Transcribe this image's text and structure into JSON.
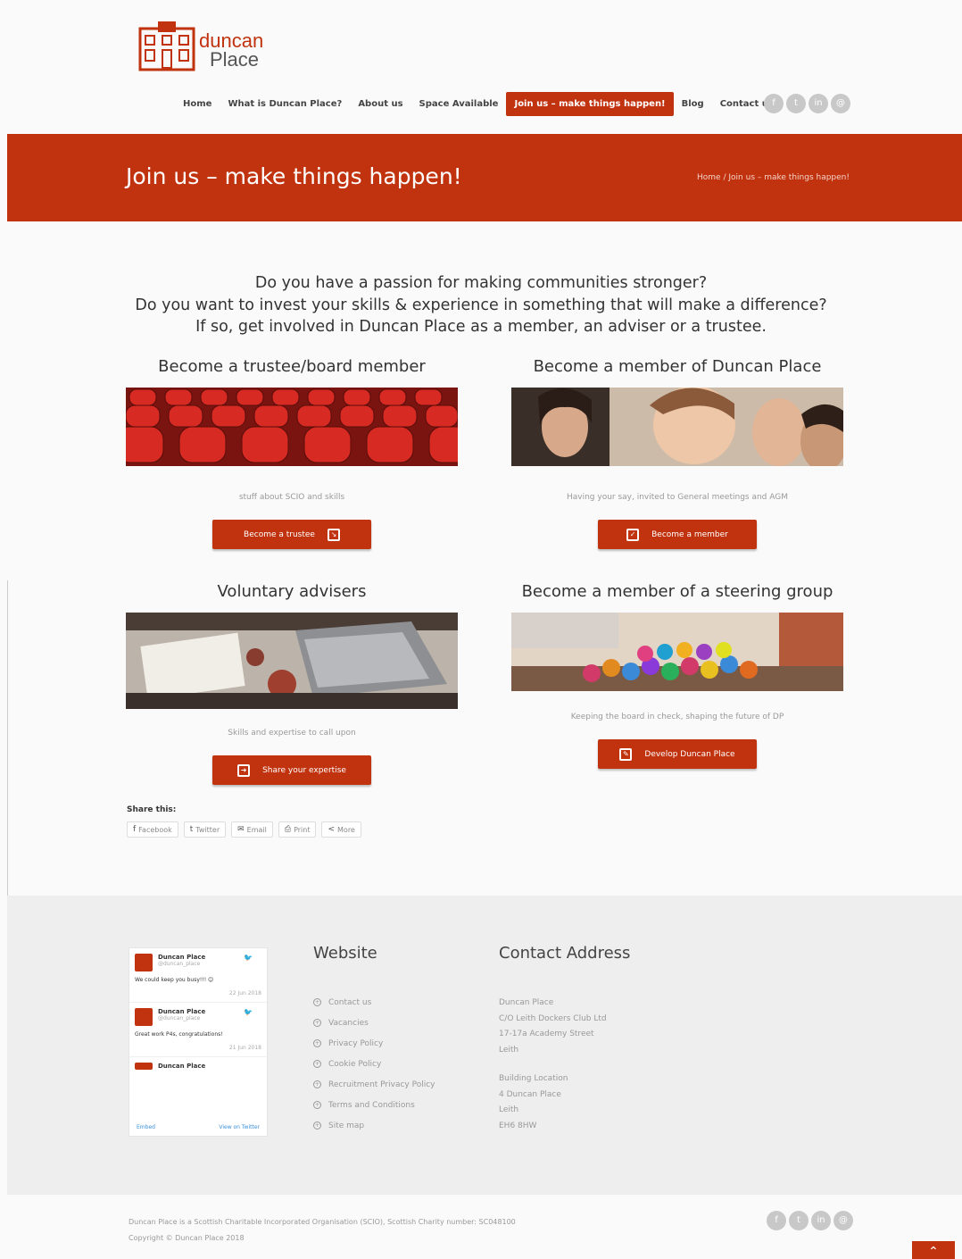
{
  "logo": {
    "line1": "duncan",
    "line2": "Place"
  },
  "nav": {
    "items": [
      "Home",
      "What is Duncan Place?",
      "About us",
      "Space Available",
      "Join us – make things happen!",
      "Blog",
      "Contact us"
    ],
    "active_index": 4
  },
  "social": [
    "facebook-icon",
    "twitter-icon",
    "linkedin-icon",
    "email-icon"
  ],
  "banner": {
    "title": "Join us – make things happen!",
    "breadcrumb_home": "Home",
    "breadcrumb_sep": "/",
    "breadcrumb_current": "Join us – make things happen!"
  },
  "intro": {
    "line1": "Do you have a passion for making communities stronger?",
    "line2": "Do you want to invest your skills & experience in something that will make a difference?",
    "line3": "If so, get involved in Duncan Place as a member, an adviser or a trustee."
  },
  "blocks": [
    {
      "title": "Become a trustee/board member",
      "caption": "stuff about SCIO and skills",
      "button": "Become a trustee"
    },
    {
      "title": "Become a member of Duncan Place",
      "caption": "Having your say, invited to General meetings and AGM",
      "button": "Become a member"
    },
    {
      "title": "Voluntary advisers",
      "caption": "Skills and expertise to call upon",
      "button": "Share your expertise"
    },
    {
      "title": "Become a member of a steering group",
      "caption": "Keeping the board in check, shaping the future of DP",
      "button": "Develop Duncan Place"
    }
  ],
  "share": {
    "label": "Share this:",
    "buttons": [
      "Facebook",
      "Twitter",
      "Email",
      "Print",
      "More"
    ]
  },
  "twitter": {
    "tweets": [
      {
        "name": "Duncan Place",
        "handle": "@duncan_place",
        "text": "We could keep you busy!!! 😊",
        "date": "22 Jun 2018"
      },
      {
        "name": "Duncan Place",
        "handle": "@duncan_place",
        "text": "Great work P4s, congratulations!",
        "date": "21 Jun 2018"
      },
      {
        "name": "Duncan Place",
        "handle": "",
        "text": "",
        "date": ""
      }
    ],
    "embed": "Embed",
    "view": "View on Twitter"
  },
  "footer": {
    "website_title": "Website",
    "links": [
      "Contact us",
      "Vacancies",
      "Privacy Policy",
      "Cookie Policy",
      "Recruitment Privacy Policy",
      "Terms and Conditions",
      "Site map"
    ],
    "contact_title": "Contact Address",
    "address1": [
      "Duncan Place",
      "C/O Leith Dockers Club Ltd",
      "17-17a Academy Street",
      "Leith"
    ],
    "address2": [
      "Building Location",
      "4 Duncan Place",
      "Leith",
      "EH6 8HW"
    ],
    "copy1": "Duncan Place is a Scottish Charitable Incorporated Organisation (SCIO), Scottish Charity number: SC048100",
    "copy2": "Copyright © Duncan Place 2018"
  },
  "colors": {
    "brand": "#c1330f"
  }
}
